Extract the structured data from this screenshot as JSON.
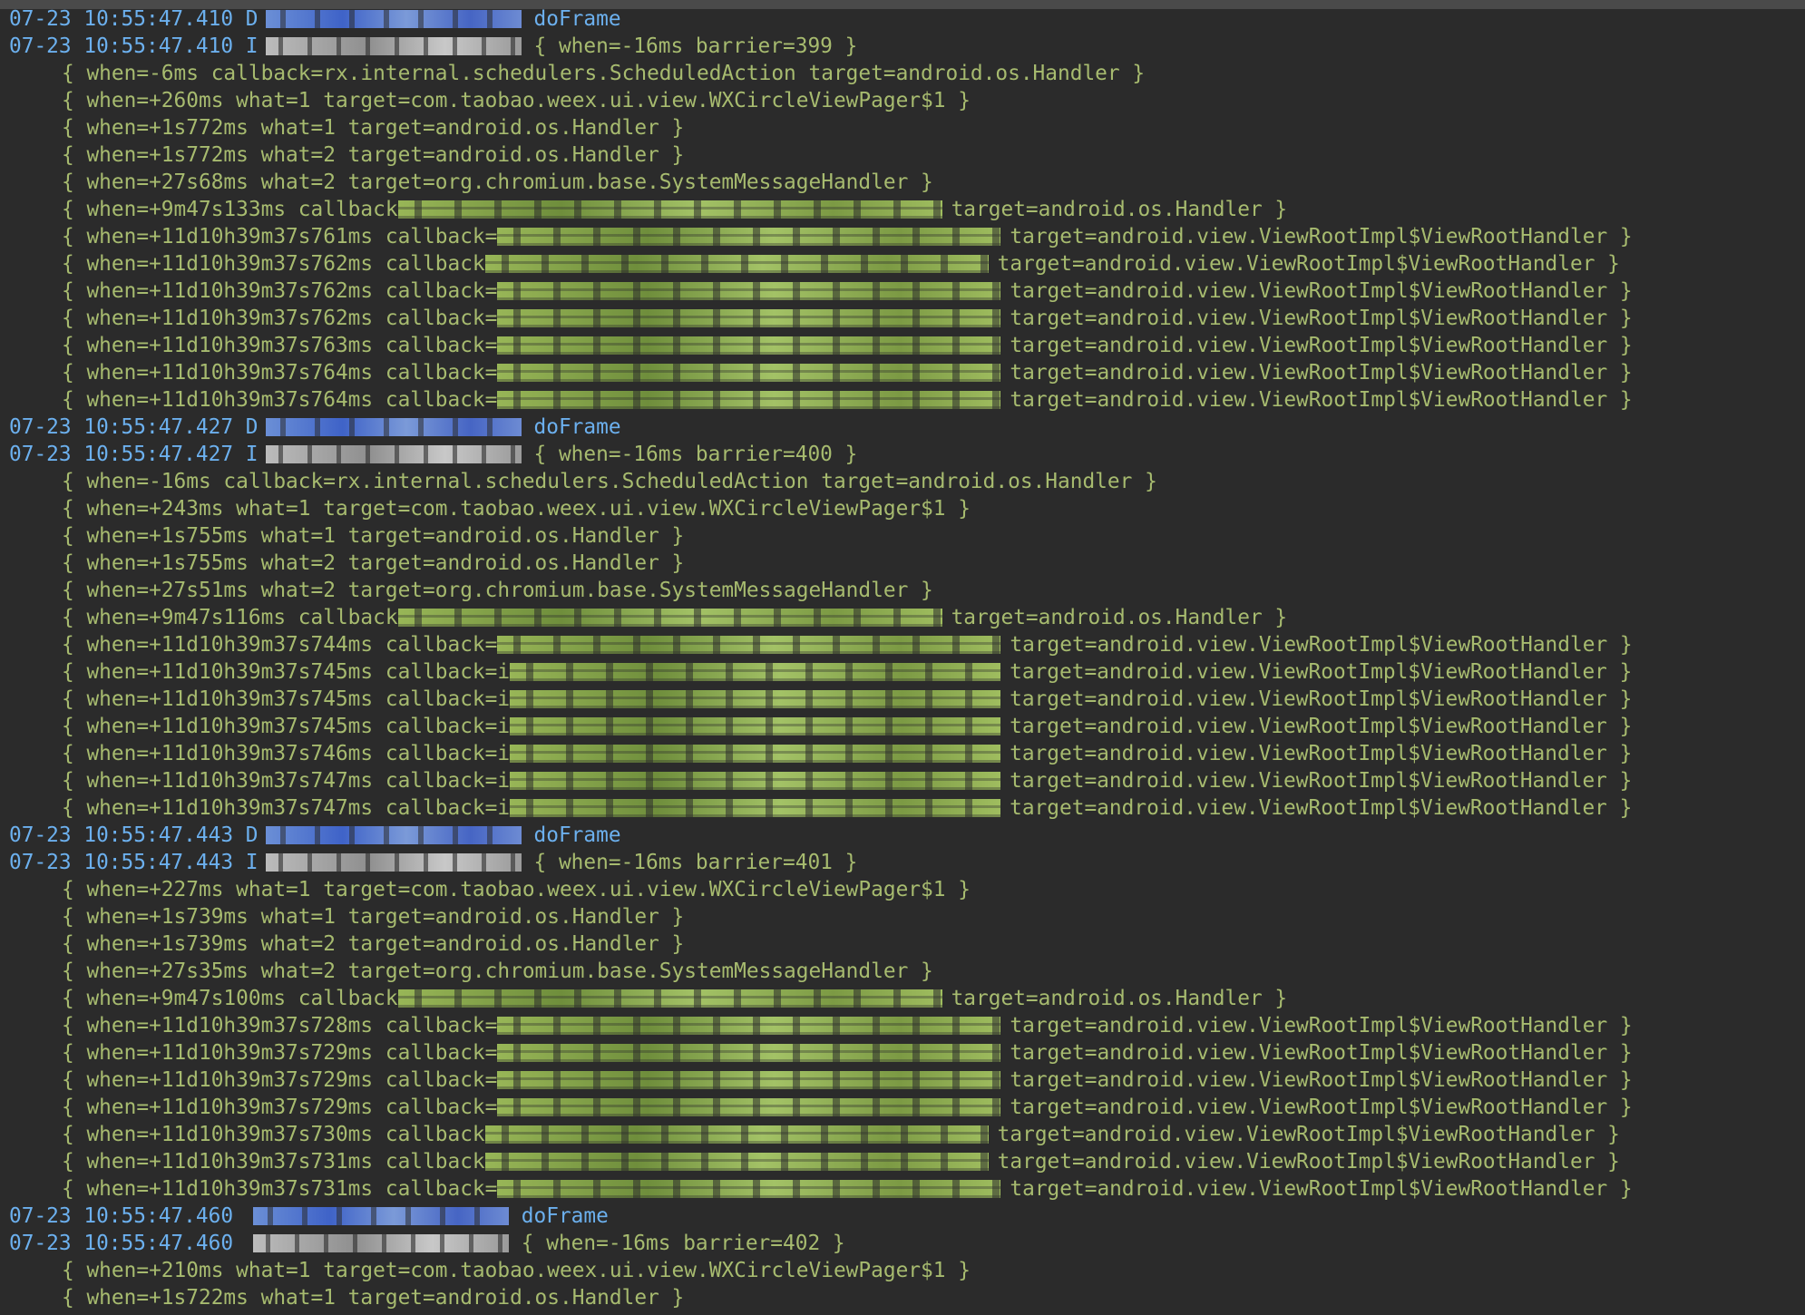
{
  "log": [
    {
      "ts": "07-23 10:55:47.410",
      "level": "D",
      "redact": "blue",
      "msg": "doFrame",
      "msg_color": "blue"
    },
    {
      "ts": "07-23 10:55:47.410",
      "level": "I",
      "redact": "grey",
      "msg": "{ when=-16ms barrier=399 }"
    },
    {
      "indent": true,
      "msg": "{ when=-6ms callback=rx.internal.schedulers.ScheduledAction target=android.os.Handler }"
    },
    {
      "indent": true,
      "msg": "{ when=+260ms what=1 target=com.taobao.weex.ui.view.WXCircleViewPager$1 }"
    },
    {
      "indent": true,
      "msg": "{ when=+1s772ms what=1 target=android.os.Handler }"
    },
    {
      "indent": true,
      "msg": "{ when=+1s772ms what=2 target=android.os.Handler }"
    },
    {
      "indent": true,
      "msg": "{ when=+27s68ms what=2 target=org.chromium.base.SystemMessageHandler }"
    },
    {
      "indent": true,
      "pre": "{ when=+9m47s133ms callback",
      "mid_w": 600,
      "post": "target=android.os.Handler }"
    },
    {
      "indent": true,
      "pre": "{ when=+11d10h39m37s761ms callback=",
      "mid_w": 555,
      "post": "target=android.view.ViewRootImpl$ViewRootHandler }"
    },
    {
      "indent": true,
      "pre": "{ when=+11d10h39m37s762ms callback",
      "mid_w": 555,
      "post": "target=android.view.ViewRootImpl$ViewRootHandler }"
    },
    {
      "indent": true,
      "pre": "{ when=+11d10h39m37s762ms callback=",
      "mid_w": 555,
      "post": "target=android.view.ViewRootImpl$ViewRootHandler }"
    },
    {
      "indent": true,
      "pre": "{ when=+11d10h39m37s762ms callback=",
      "mid_w": 555,
      "post": "target=android.view.ViewRootImpl$ViewRootHandler }"
    },
    {
      "indent": true,
      "pre": "{ when=+11d10h39m37s763ms callback=",
      "mid_w": 555,
      "post": "target=android.view.ViewRootImpl$ViewRootHandler }"
    },
    {
      "indent": true,
      "pre": "{ when=+11d10h39m37s764ms callback=",
      "mid_w": 555,
      "post": "target=android.view.ViewRootImpl$ViewRootHandler }"
    },
    {
      "indent": true,
      "pre": "{ when=+11d10h39m37s764ms callback=",
      "mid_w": 555,
      "post": "target=android.view.ViewRootImpl$ViewRootHandler }"
    },
    {
      "ts": "07-23 10:55:47.427",
      "level": "D",
      "redact": "blue",
      "msg": "doFrame",
      "msg_color": "blue"
    },
    {
      "ts": "07-23 10:55:47.427",
      "level": "I",
      "redact": "grey",
      "msg": "{ when=-16ms barrier=400 }"
    },
    {
      "indent": true,
      "msg": "{ when=-16ms callback=rx.internal.schedulers.ScheduledAction target=android.os.Handler }"
    },
    {
      "indent": true,
      "msg": "{ when=+243ms what=1 target=com.taobao.weex.ui.view.WXCircleViewPager$1 }"
    },
    {
      "indent": true,
      "msg": "{ when=+1s755ms what=1 target=android.os.Handler }"
    },
    {
      "indent": true,
      "msg": "{ when=+1s755ms what=2 target=android.os.Handler }"
    },
    {
      "indent": true,
      "msg": "{ when=+27s51ms what=2 target=org.chromium.base.SystemMessageHandler }"
    },
    {
      "indent": true,
      "pre": "{ when=+9m47s116ms callback",
      "mid_w": 600,
      "post": "target=android.os.Handler }"
    },
    {
      "indent": true,
      "pre": "{ when=+11d10h39m37s744ms callback=",
      "mid_w": 555,
      "post": "target=android.view.ViewRootImpl$ViewRootHandler }"
    },
    {
      "indent": true,
      "pre": "{ when=+11d10h39m37s745ms callback=i",
      "mid_w": 541,
      "post": "target=android.view.ViewRootImpl$ViewRootHandler }"
    },
    {
      "indent": true,
      "pre": "{ when=+11d10h39m37s745ms callback=i",
      "mid_w": 541,
      "post": "target=android.view.ViewRootImpl$ViewRootHandler }"
    },
    {
      "indent": true,
      "pre": "{ when=+11d10h39m37s745ms callback=i",
      "mid_w": 541,
      "post": "target=android.view.ViewRootImpl$ViewRootHandler }"
    },
    {
      "indent": true,
      "pre": "{ when=+11d10h39m37s746ms callback=i",
      "mid_w": 541,
      "post": "target=android.view.ViewRootImpl$ViewRootHandler }"
    },
    {
      "indent": true,
      "pre": "{ when=+11d10h39m37s747ms callback=i",
      "mid_w": 541,
      "post": "target=android.view.ViewRootImpl$ViewRootHandler }"
    },
    {
      "indent": true,
      "pre": "{ when=+11d10h39m37s747ms callback=i",
      "mid_w": 541,
      "post": "target=android.view.ViewRootImpl$ViewRootHandler }"
    },
    {
      "ts": "07-23 10:55:47.443",
      "level": "D",
      "redact": "blue",
      "msg": "doFrame",
      "msg_color": "blue"
    },
    {
      "ts": "07-23 10:55:47.443",
      "level": "I",
      "redact": "grey",
      "msg": "{ when=-16ms barrier=401 }"
    },
    {
      "indent": true,
      "msg": "{ when=+227ms what=1 target=com.taobao.weex.ui.view.WXCircleViewPager$1 }"
    },
    {
      "indent": true,
      "msg": "{ when=+1s739ms what=1 target=android.os.Handler }"
    },
    {
      "indent": true,
      "msg": "{ when=+1s739ms what=2 target=android.os.Handler }"
    },
    {
      "indent": true,
      "msg": "{ when=+27s35ms what=2 target=org.chromium.base.SystemMessageHandler }"
    },
    {
      "indent": true,
      "pre": "{ when=+9m47s100ms callback",
      "mid_w": 600,
      "post": "target=android.os.Handler }"
    },
    {
      "indent": true,
      "pre": "{ when=+11d10h39m37s728ms callback=",
      "mid_w": 555,
      "post": "target=android.view.ViewRootImpl$ViewRootHandler }"
    },
    {
      "indent": true,
      "pre": "{ when=+11d10h39m37s729ms callback=",
      "mid_w": 555,
      "post": "target=android.view.ViewRootImpl$ViewRootHandler }"
    },
    {
      "indent": true,
      "pre": "{ when=+11d10h39m37s729ms callback=",
      "mid_w": 555,
      "post": "target=android.view.ViewRootImpl$ViewRootHandler }"
    },
    {
      "indent": true,
      "pre": "{ when=+11d10h39m37s729ms callback=",
      "mid_w": 555,
      "post": "target=android.view.ViewRootImpl$ViewRootHandler }"
    },
    {
      "indent": true,
      "pre": "{ when=+11d10h39m37s730ms callback",
      "mid_w": 555,
      "post": "target=android.view.ViewRootImpl$ViewRootHandler }"
    },
    {
      "indent": true,
      "pre": "{ when=+11d10h39m37s731ms callback",
      "mid_w": 555,
      "post": "target=android.view.ViewRootImpl$ViewRootHandler }"
    },
    {
      "indent": true,
      "pre": "{ when=+11d10h39m37s731ms callback=",
      "mid_w": 555,
      "post": "target=android.view.ViewRootImpl$ViewRootHandler }"
    },
    {
      "ts": "07-23 10:55:47.460",
      "level": "",
      "redact": "blue",
      "msg": "doFrame",
      "msg_color": "blue"
    },
    {
      "ts": "07-23 10:55:47.460",
      "level": "",
      "redact": "grey",
      "msg": "{ when=-16ms barrier=402 }"
    },
    {
      "indent": true,
      "msg": "{ when=+210ms what=1 target=com.taobao.weex.ui.view.WXCircleViewPager$1 }"
    },
    {
      "indent": true,
      "msg": "{ when=+1s722ms what=1 target=android.os.Handler }"
    }
  ]
}
